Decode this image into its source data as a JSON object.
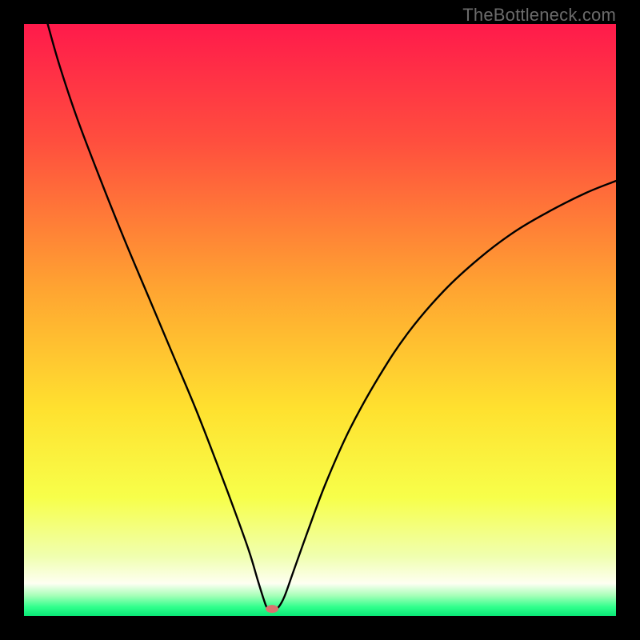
{
  "watermark": "TheBottleneck.com",
  "chart_data": {
    "type": "line",
    "title": "",
    "xlabel": "",
    "ylabel": "",
    "xlim": [
      0,
      100
    ],
    "ylim": [
      0,
      100
    ],
    "gradient_stops": [
      {
        "offset": 0.0,
        "color": "#ff1a4b"
      },
      {
        "offset": 0.2,
        "color": "#ff4f3e"
      },
      {
        "offset": 0.45,
        "color": "#ffa531"
      },
      {
        "offset": 0.65,
        "color": "#ffe12f"
      },
      {
        "offset": 0.8,
        "color": "#f7ff4a"
      },
      {
        "offset": 0.9,
        "color": "#f0ffb0"
      },
      {
        "offset": 0.945,
        "color": "#fefff2"
      },
      {
        "offset": 0.965,
        "color": "#a9ffb9"
      },
      {
        "offset": 0.985,
        "color": "#2fff8c"
      },
      {
        "offset": 1.0,
        "color": "#09e876"
      }
    ],
    "series": [
      {
        "name": "curve",
        "points": [
          {
            "x": 4.0,
            "y": 100.0
          },
          {
            "x": 6.0,
            "y": 93.0
          },
          {
            "x": 9.0,
            "y": 84.0
          },
          {
            "x": 13.0,
            "y": 73.5
          },
          {
            "x": 17.0,
            "y": 63.5
          },
          {
            "x": 21.0,
            "y": 54.0
          },
          {
            "x": 25.0,
            "y": 44.5
          },
          {
            "x": 29.0,
            "y": 35.0
          },
          {
            "x": 32.5,
            "y": 26.0
          },
          {
            "x": 35.5,
            "y": 18.0
          },
          {
            "x": 38.0,
            "y": 11.0
          },
          {
            "x": 39.5,
            "y": 6.0
          },
          {
            "x": 40.5,
            "y": 2.8
          },
          {
            "x": 41.0,
            "y": 1.5
          },
          {
            "x": 41.6,
            "y": 1.0
          },
          {
            "x": 42.2,
            "y": 1.0
          },
          {
            "x": 43.0,
            "y": 1.5
          },
          {
            "x": 44.0,
            "y": 3.3
          },
          {
            "x": 45.5,
            "y": 7.5
          },
          {
            "x": 48.0,
            "y": 14.5
          },
          {
            "x": 51.0,
            "y": 22.5
          },
          {
            "x": 55.0,
            "y": 31.5
          },
          {
            "x": 60.0,
            "y": 40.5
          },
          {
            "x": 65.0,
            "y": 48.0
          },
          {
            "x": 71.0,
            "y": 55.0
          },
          {
            "x": 77.0,
            "y": 60.5
          },
          {
            "x": 83.0,
            "y": 65.0
          },
          {
            "x": 89.0,
            "y": 68.5
          },
          {
            "x": 95.0,
            "y": 71.5
          },
          {
            "x": 100.0,
            "y": 73.5
          }
        ]
      }
    ],
    "marker": {
      "x": 41.9,
      "y": 1.2,
      "color": "#d9736f",
      "rx": 8,
      "ry": 5
    }
  }
}
